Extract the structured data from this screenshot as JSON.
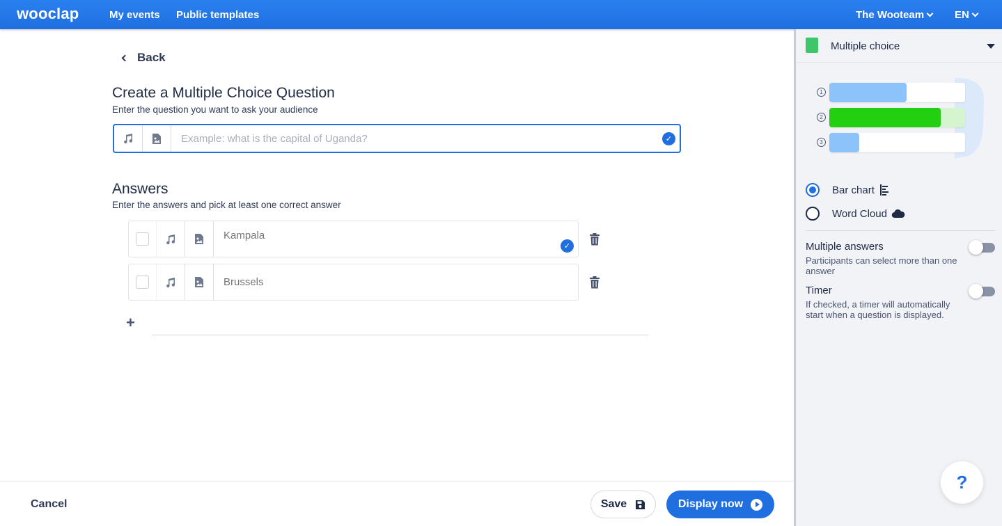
{
  "nav": {
    "logo": "wooclap",
    "my_events": "My events",
    "public_templates": "Public templates",
    "workspace": "The Wooteam",
    "language": "EN"
  },
  "editor": {
    "back": "Back",
    "title": "Create a Multiple Choice Question",
    "subtitle": "Enter the question you want to ask your audience",
    "question_placeholder": "Example: what is the capital of Uganda?",
    "answers_title": "Answers",
    "answers_subtitle": "Enter the answers and pick at least one correct answer",
    "answers": [
      {
        "placeholder": "Kampala",
        "checked": false
      },
      {
        "placeholder": "Brussels",
        "checked": false
      }
    ]
  },
  "footer": {
    "cancel": "Cancel",
    "save": "Save",
    "display_now": "Display now"
  },
  "panel": {
    "question_type": "Multiple choice",
    "preview_bars": [
      {
        "num": "1",
        "fill": 0.57,
        "color": "#8cc3fa"
      },
      {
        "num": "2",
        "fill": 0.82,
        "color": "#22d011"
      },
      {
        "num": "3",
        "fill": 0.22,
        "color": "#8cc3fa"
      }
    ],
    "display_options": [
      {
        "label": "Bar chart",
        "selected": true
      },
      {
        "label": "Word Cloud",
        "selected": false
      }
    ],
    "multiple_answers": {
      "title": "Multiple answers",
      "desc": "Participants can select more than one answer",
      "enabled": false
    },
    "timer": {
      "title": "Timer",
      "desc": "If checked, a timer will automatically start when a question is displayed.",
      "enabled": false
    },
    "help": "?"
  },
  "colors": {
    "brand": "#1f6fe0",
    "correct_green": "#22d011",
    "bar_blue": "#8cc3fa"
  }
}
